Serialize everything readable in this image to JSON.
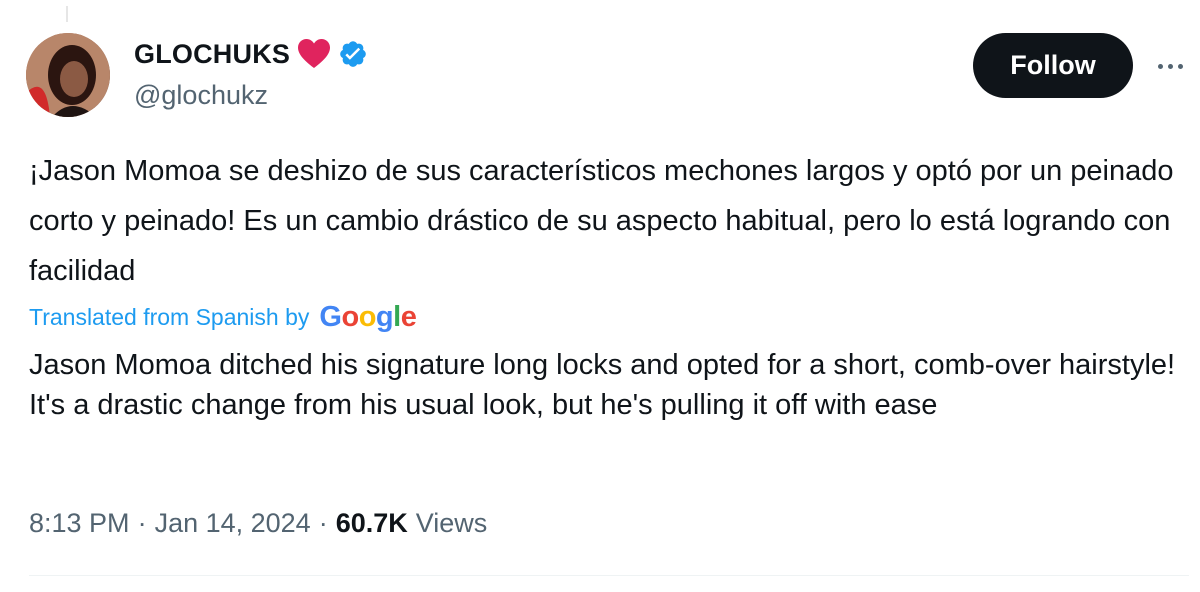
{
  "author": {
    "display_name": "GLOCHUKS",
    "handle": "@glochukz",
    "emoji": "heart-emoji",
    "verified_icon": "verified-badge-icon",
    "verified_color": "#1d9bf0",
    "heart_color": "#e0245e"
  },
  "actions": {
    "follow_label": "Follow",
    "more_icon": "more-horizontal-icon"
  },
  "tweet": {
    "text": "¡Jason Momoa se deshizo de sus característicos mechones largos y optó por un peinado corto y peinado! Es un cambio drástico de su aspecto habitual, pero lo está logrando con facilidad",
    "translated_label": "Translated from Spanish by",
    "translator": "Google",
    "translation": "Jason Momoa ditched his signature long locks and opted for a short, comb-over hairstyle! It's a drastic change from his usual look, but he's pulling it off with ease"
  },
  "meta": {
    "time": "8:13 PM",
    "separator": "·",
    "date": "Jan 14, 2024",
    "views_count": "60.7K",
    "views_label": "Views"
  },
  "colors": {
    "link_blue": "#1d9bf0",
    "text_primary": "#0f1419",
    "text_secondary": "#536471",
    "button_bg": "#0f1419"
  }
}
